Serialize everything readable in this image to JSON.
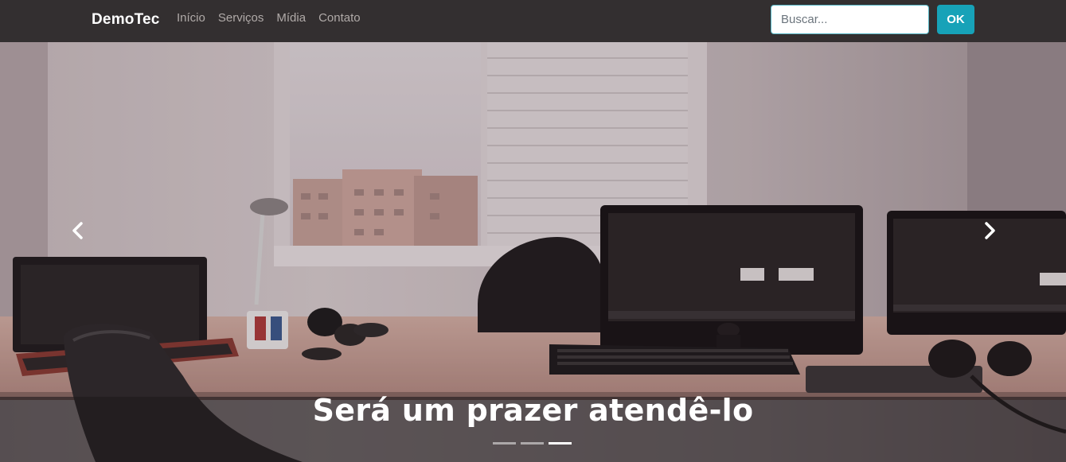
{
  "navbar": {
    "brand": "DemoTec",
    "links": [
      "Início",
      "Serviços",
      "Mídia",
      "Contato"
    ],
    "search": {
      "placeholder": "Buscar...",
      "value": ""
    },
    "search_button": "OK"
  },
  "carousel": {
    "caption": "Será um prazer atendê-lo",
    "slides": 3,
    "active_slide": 3,
    "icons": {
      "prev": "chevron-left-icon",
      "next": "chevron-right-icon"
    }
  },
  "colors": {
    "navbar_bg": "#332f30",
    "brand": "#ffffff",
    "nav_link": "#b0aaa8",
    "button_accent": "#17a2b8"
  }
}
